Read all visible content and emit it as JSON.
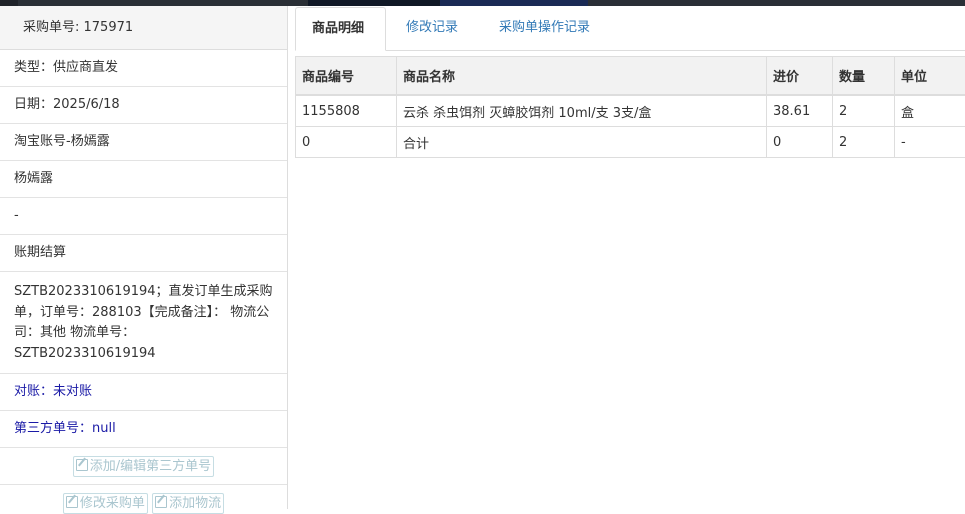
{
  "order_header": "采购单号: 175971",
  "info_rows": [
    "类型：供应商直发",
    "日期：2025/6/18",
    "淘宝账号-杨嫣露",
    "杨嫣露",
    "-",
    "账期结算"
  ],
  "note": "SZTB2023310619194；直发订单生成采购单，订单号：288103【完成备注】： 物流公司：其他 物流单号：SZTB2023310619194",
  "reconcile": "对账：未对账",
  "third_party": "第三方单号：null",
  "buttons": {
    "edit_third_party": "添加/编辑第三方单号",
    "edit_order": "修改采购单",
    "add_logistics": "添加物流"
  },
  "tabs": [
    "商品明细",
    "修改记录",
    "采购单操作记录"
  ],
  "table": {
    "headers": [
      "商品编号",
      "商品名称",
      "进价",
      "数量",
      "单位"
    ],
    "rows": [
      [
        "1155808",
        "云杀 杀虫饵剂 灭蟑胶饵剂 10ml/支 3支/盒",
        "38.61",
        "2",
        "盒"
      ],
      [
        "0",
        "合计",
        "0",
        "2",
        "-"
      ]
    ]
  },
  "colors": {
    "link": "#1a1aa6",
    "tab_link": "#337ab7",
    "ghost_button": "#aac6cf"
  }
}
